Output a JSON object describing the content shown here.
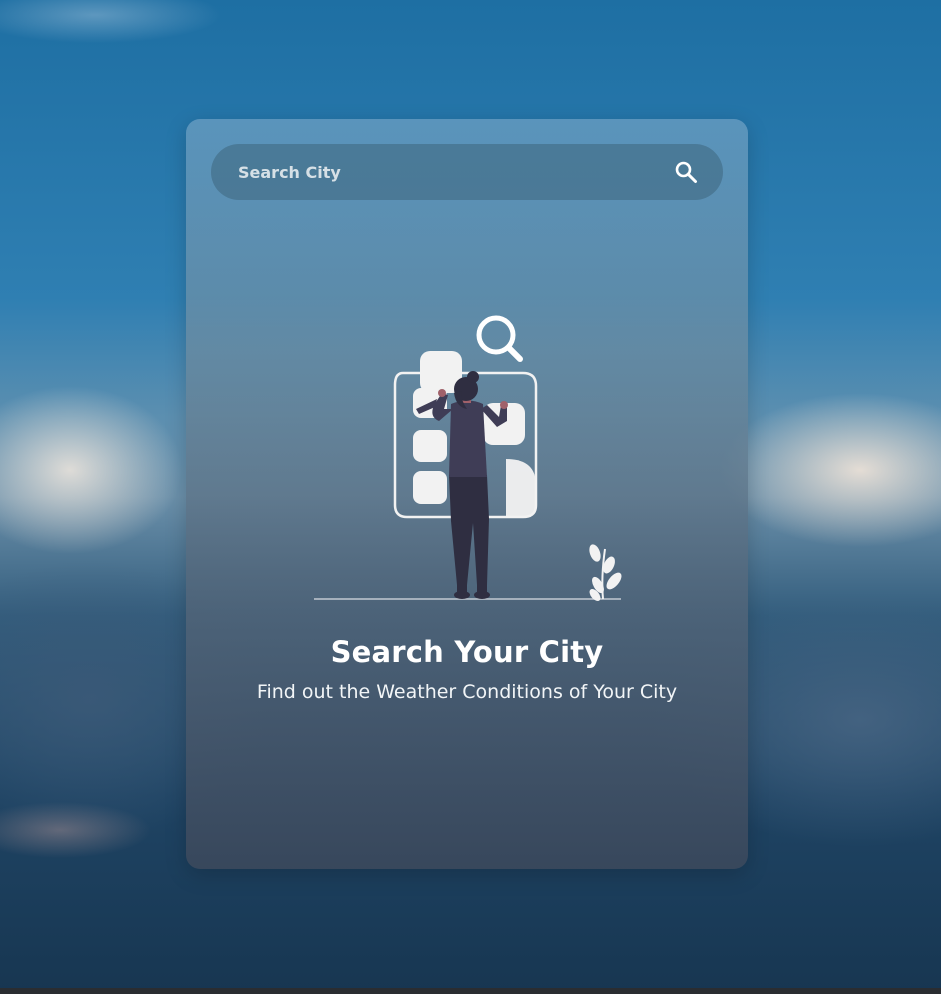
{
  "search": {
    "placeholder": "Search City",
    "value": "",
    "button_icon": "search-icon"
  },
  "empty_state": {
    "title": "Search Your City",
    "subtitle": "Find out the Weather Conditions of Your City",
    "illustration": "person-searching-illustration"
  },
  "colors": {
    "text": "#ffffff",
    "figure_dark": "#2f2e41",
    "figure_shirt": "#3f3d56",
    "skin": "#a0616a",
    "tile": "#f2f2f2"
  }
}
